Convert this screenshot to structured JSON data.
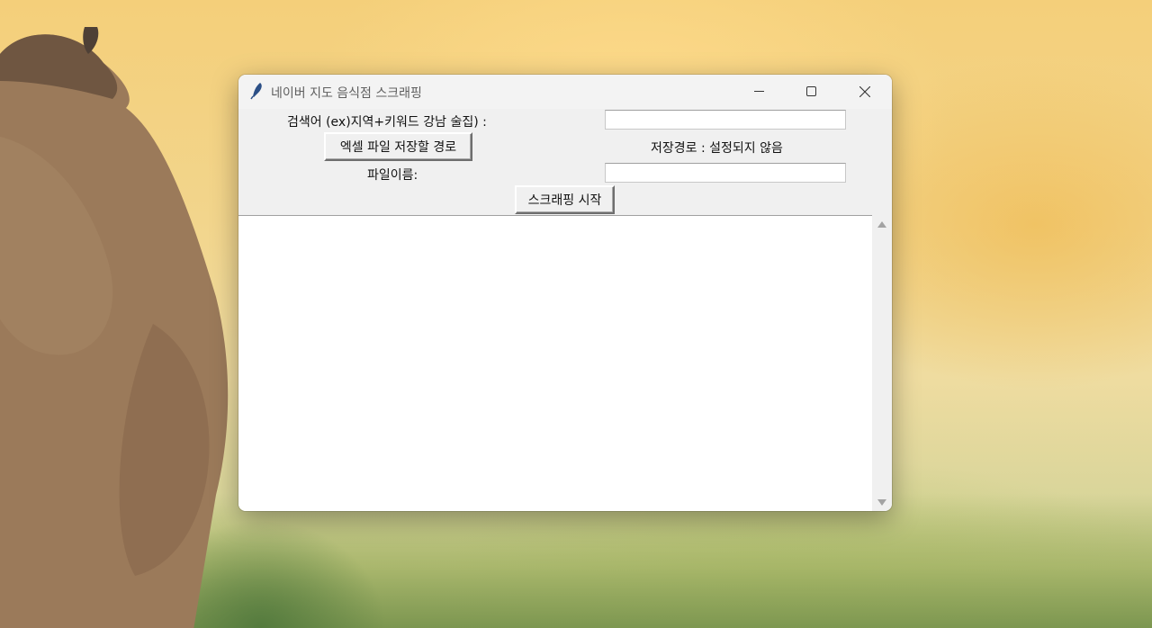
{
  "window": {
    "title": "네이버 지도 음식점 스크래핑",
    "icon": "feather-icon",
    "controls": [
      "minimize-icon",
      "maximize-icon",
      "close-icon"
    ]
  },
  "form": {
    "search_label": "검색어 (ex)지역+키워드 강남 술집) :",
    "search_value": "",
    "save_path_button": "엑셀 파일 저장할 경로",
    "save_path_status": "저장경로 : 설정되지 않음",
    "filename_label": "파일이름:",
    "filename_value": "",
    "start_button": "스크래핑 시작"
  },
  "log": {
    "text": ""
  }
}
